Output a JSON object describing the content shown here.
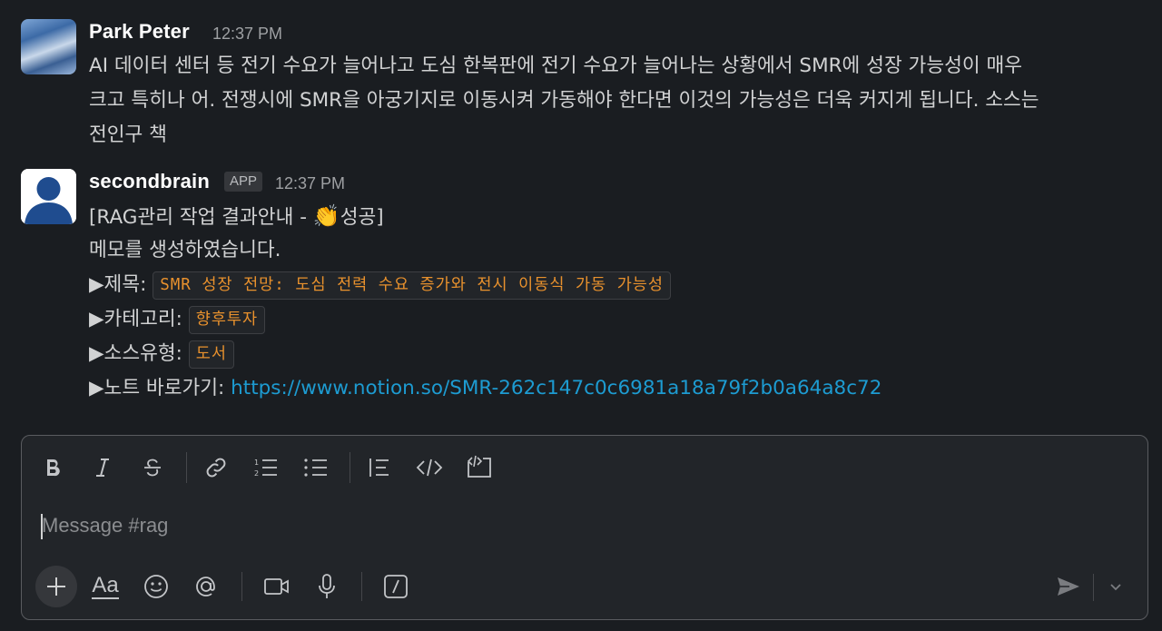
{
  "messages": [
    {
      "author": "Park Peter",
      "time": "12:37 PM",
      "lines": [
        "AI 데이터 센터 등 전기 수요가 늘어나고 도심 한복판에 전기 수요가 늘어나는 상황에서 SMR에 성장 가능성이 매우",
        "크고 특히나 어. 전쟁시에 SMR을 아궁기지로 이동시켜 가동해야 한다면 이것의 가능성은 더욱 커지게 됩니다. 소스는",
        "전인구 책"
      ]
    },
    {
      "author": "secondbrain",
      "badge": "APP",
      "time": "12:37 PM",
      "header_prefix": "[RAG관리 작업 결과안내 - ",
      "header_emoji": "👏",
      "header_suffix": "성공]",
      "created": "메모를 생성하였습니다.",
      "title_label": "▶제목: ",
      "title_value": "SMR 성장 전망: 도심 전력 수요 증가와 전시 이동식 가동 가능성",
      "category_label": "▶카테고리: ",
      "category_value": "향후투자",
      "source_label": "▶소스유형: ",
      "source_value": "도서",
      "note_label": "▶노트 바로가기: ",
      "note_link": "https://www.notion.so/SMR-262c147c0c6981a18a79f2b0a64a8c72"
    }
  ],
  "composer": {
    "placeholder": "Message #rag",
    "aa_label": "Aa",
    "toolbar": [
      "bold-icon",
      "italic-icon",
      "strikethrough-icon",
      "link-icon",
      "ordered-list-icon",
      "bulleted-list-icon",
      "blockquote-icon",
      "code-icon",
      "code-block-icon"
    ],
    "bottom": [
      "plus-icon",
      "formatting-icon",
      "emoji-icon",
      "mention-icon",
      "video-icon",
      "microphone-icon",
      "slash-command-icon",
      "send-icon",
      "chevron-down-icon"
    ]
  }
}
